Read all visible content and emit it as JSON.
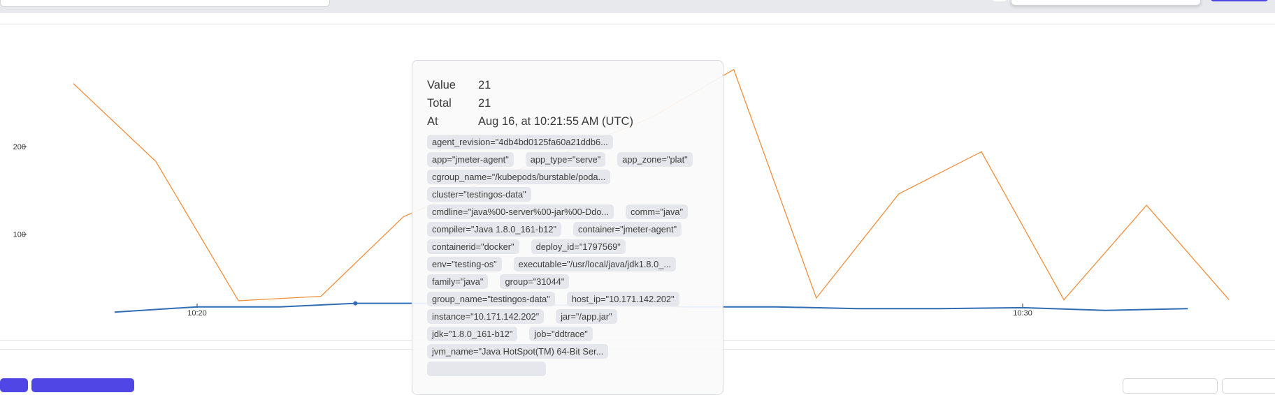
{
  "chart_data": {
    "type": "line",
    "x_ticks": [
      "10:20",
      "10:30"
    ],
    "y_ticks": [
      100,
      200
    ],
    "ylim": [
      0,
      300
    ],
    "grid": false,
    "series": [
      {
        "color": "#f28e3c",
        "x": [
          "10:18:30",
          "10:19:30",
          "10:20:30",
          "10:21:30",
          "10:22:30",
          "10:23:30",
          "10:24:30",
          "10:25:30",
          "10:26:30",
          "10:27:30",
          "10:28:30",
          "10:29:30",
          "10:30:30",
          "10:31:30",
          "10:32:30"
        ],
        "values": [
          272,
          183,
          24,
          29,
          120,
          160,
          195,
          233,
          288,
          27,
          146,
          194,
          25,
          133,
          25
        ]
      },
      {
        "color": "#2f6db5",
        "x": [
          "10:19",
          "10:20",
          "10:21",
          "10:21:55",
          "10:23",
          "10:24",
          "10:25",
          "10:26",
          "10:27",
          "10:28",
          "10:29",
          "10:30",
          "10:31",
          "10:32"
        ],
        "values": [
          11,
          17,
          17,
          21,
          21,
          19,
          19,
          17,
          17,
          15,
          15,
          16,
          13,
          15
        ]
      }
    ]
  },
  "tooltip": {
    "value_label": "Value",
    "value": "21",
    "total_label": "Total",
    "total": "21",
    "at_label": "At",
    "at": "Aug 16, at 10:21:55 AM (UTC)",
    "labels": [
      "agent_revision=\"4db4bd0125fa60a21ddb6...",
      "app=\"jmeter-agent\"",
      "app_type=\"serve\"",
      "app_zone=\"plat\"",
      "cgroup_name=\"/kubepods/burstable/poda...",
      "cluster=\"testingos-data\"",
      "cmdline=\"java%00-server%00-jar%00-Ddo...",
      "comm=\"java\"",
      "compiler=\"Java 1.8.0_161-b12\"",
      "container=\"jmeter-agent\"",
      "containerid=\"docker\"",
      "deploy_id=\"1797569\"",
      "env=\"testing-os\"",
      "executable=\"/usr/local/java/jdk1.8.0_...",
      "family=\"java\"",
      "group=\"31044\"",
      "group_name=\"testingos-data\"",
      "host_ip=\"10.171.142.202\"",
      "instance=\"10.171.142.202\"",
      "jar=\"/app.jar\"",
      "jdk=\"1.8.0_161-b12\"",
      "job=\"ddtrace\"",
      "jvm_name=\"Java HotSpot(TM) 64-Bit Ser...",
      ""
    ]
  }
}
